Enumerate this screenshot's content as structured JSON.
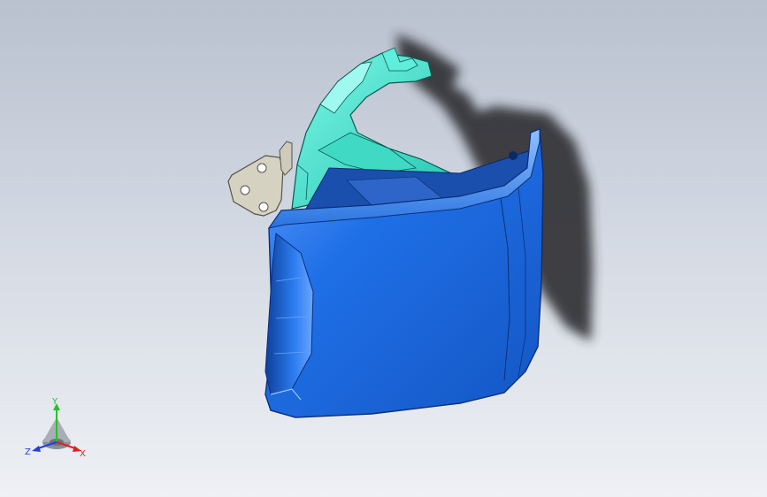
{
  "viewport": {
    "background_top": "#b9c1cf",
    "background_bottom": "#eef0f4"
  },
  "model": {
    "cover_color": "#1f6fe6",
    "cover_highlight": "#6aa6ff",
    "bracket_color": "#33e0c8",
    "hinge_color": "#d8d4c4",
    "shadow_color": "#2c2c2c"
  },
  "triad": {
    "y_label": "Y",
    "x_label": "X",
    "z_label": "Z",
    "y_color": "#28c028",
    "x_color": "#e02020",
    "z_color": "#2040e0"
  }
}
